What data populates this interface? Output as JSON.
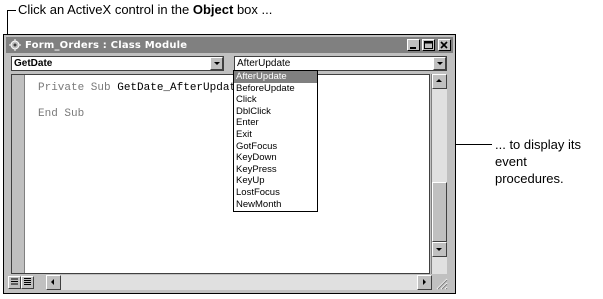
{
  "callouts": {
    "top_prefix": "Click an ActiveX control in the ",
    "top_bold": "Object",
    "top_suffix": " box ...",
    "right_line1": "... to display its event",
    "right_line2": "procedures."
  },
  "window": {
    "title": "Form_Orders : Class Module",
    "object_combo_value": "GetDate",
    "procedure_combo_value": "AfterUpdate"
  },
  "code": {
    "line1_keyword": "Private Sub ",
    "line1_name": "GetDate_AfterUpdat",
    "line2": "End Sub"
  },
  "dropdown": {
    "items": [
      "AfterUpdate",
      "BeforeUpdate",
      "Click",
      "DblClick",
      "Enter",
      "Exit",
      "GotFocus",
      "KeyDown",
      "KeyPress",
      "KeyUp",
      "LostFocus",
      "NewMonth"
    ],
    "selected_index": 0
  },
  "icons": {
    "app": "vba-module-icon",
    "minimize": "minimize-icon",
    "maximize": "maximize-icon",
    "close": "close-icon"
  }
}
